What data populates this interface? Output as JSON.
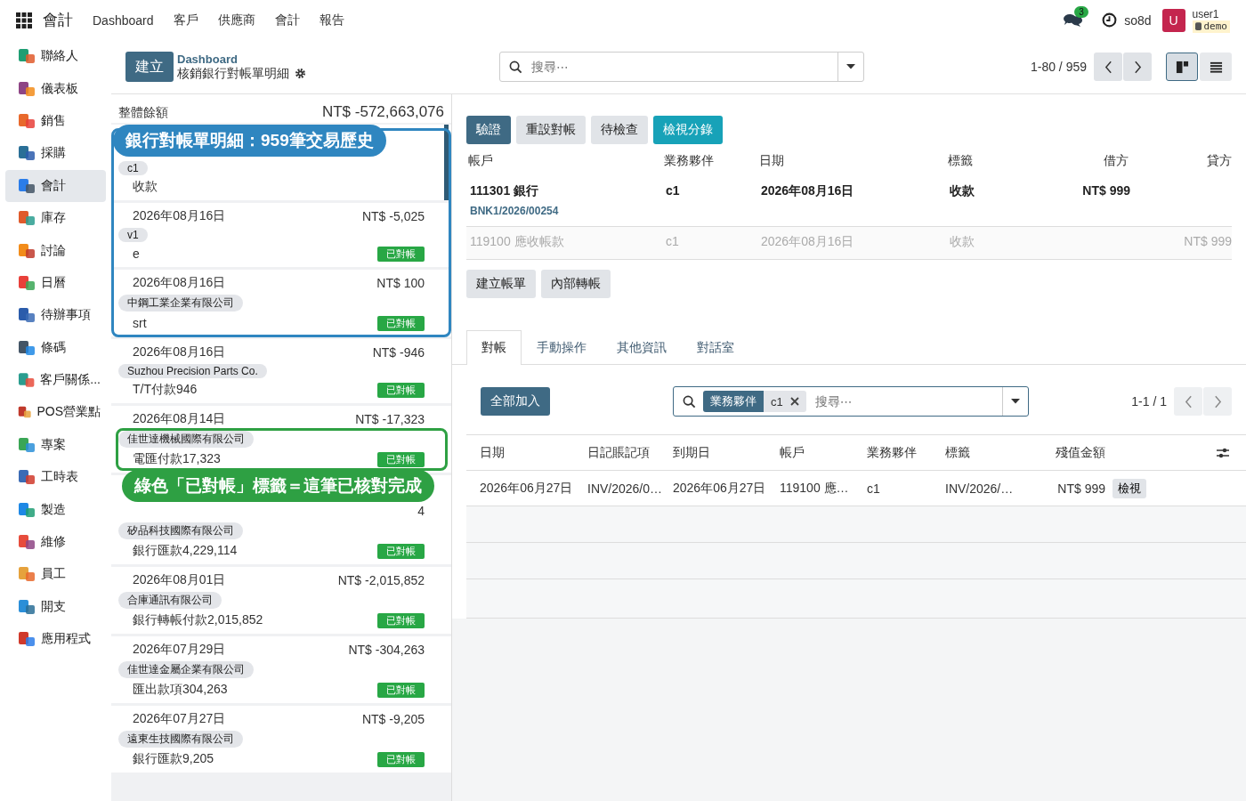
{
  "navbar": {
    "app": "會計",
    "menus": [
      "Dashboard",
      "客戶",
      "供應商",
      "會計",
      "報告"
    ],
    "messages_badge": "3",
    "clock_label": "so8d",
    "avatar": "U",
    "user": "user1",
    "database": "demo"
  },
  "sidebar": {
    "items": [
      {
        "label": "聯絡人",
        "selected": false
      },
      {
        "label": "儀表板",
        "selected": false
      },
      {
        "label": "銷售",
        "selected": false
      },
      {
        "label": "採購",
        "selected": false
      },
      {
        "label": "會計",
        "selected": true
      },
      {
        "label": "庫存",
        "selected": false
      },
      {
        "label": "討論",
        "selected": false
      },
      {
        "label": "日曆",
        "selected": false
      },
      {
        "label": "待辦事項",
        "selected": false
      },
      {
        "label": "條碼",
        "selected": false
      },
      {
        "label": "客戶關係...",
        "selected": false
      },
      {
        "label": "POS營業點",
        "selected": false
      },
      {
        "label": "專案",
        "selected": false
      },
      {
        "label": "工時表",
        "selected": false
      },
      {
        "label": "製造",
        "selected": false
      },
      {
        "label": "維修",
        "selected": false
      },
      {
        "label": "員工",
        "selected": false
      },
      {
        "label": "開支",
        "selected": false
      },
      {
        "label": "應用程式",
        "selected": false
      }
    ]
  },
  "control_panel": {
    "create": "建立",
    "breadcrumb": "Dashboard",
    "title": "核銷銀行對帳單明細",
    "search": {
      "placeholder": "搜尋⋯"
    },
    "pager": "1-80 / 959",
    "views": [
      {
        "kind": "kanban",
        "selected": true
      },
      {
        "kind": "list",
        "selected": false
      }
    ]
  },
  "statement": {
    "balance_label": "整體餘額",
    "balance": "NT$ -572,663,076",
    "lines": [
      {
        "partner": "c1",
        "label": "收款",
        "selected": true,
        "highlighted": false,
        "callout": {
          "kind": "framed",
          "text": "銀行對帳單明細：959筆交易歷史",
          "color": "#2f86c0"
        }
      },
      {
        "date": "2026年08月16日",
        "amount": "NT$ -5,025",
        "partner": "v1",
        "label": "e",
        "reconciled": true,
        "badge": "已對帳",
        "selected": false,
        "highlighted": false
      },
      {
        "date": "2026年08月16日",
        "amount": "NT$ 100",
        "partner": "中鋼工業企業有限公司",
        "label": "srt",
        "reconciled": true,
        "badge": "已對帳",
        "selected": false,
        "highlighted": false
      },
      {
        "date": "2026年08月16日",
        "amount": "NT$ -946",
        "partner": "Suzhou Precision Parts Co.",
        "label": "T/T付款946",
        "reconciled": true,
        "badge": "已對帳",
        "selected": false,
        "highlighted": false
      },
      {
        "date": "2026年08月14日",
        "amount": "NT$ -17,323",
        "partner": "佳世達機械國際有限公司",
        "label": "電匯付款17,323",
        "reconciled": true,
        "badge": "已對帳",
        "selected": false,
        "highlighted": true
      },
      {
        "amount": "4",
        "partner": "矽品科技國際有限公司",
        "label": "銀行匯款4,229,114",
        "reconciled": true,
        "badge": "已對帳",
        "selected": false,
        "highlighted": false,
        "callout": {
          "kind": "plain",
          "text": "綠色「已對帳」標籤＝這筆已核對完成",
          "color": "#2ea043"
        }
      },
      {
        "date": "2026年08月01日",
        "amount": "NT$ -2,015,852",
        "partner": "合庫通訊有限公司",
        "label": "銀行轉帳付款2,015,852",
        "reconciled": true,
        "badge": "已對帳",
        "selected": false,
        "highlighted": false
      },
      {
        "date": "2026年07月29日",
        "amount": "NT$ -304,263",
        "partner": "佳世達金屬企業有限公司",
        "label": "匯出款項304,263",
        "reconciled": true,
        "badge": "已對帳",
        "selected": false,
        "highlighted": false
      },
      {
        "date": "2026年07月27日",
        "amount": "NT$ -9,205",
        "partner": "遠東生技國際有限公司",
        "label": "銀行匯款9,205",
        "reconciled": true,
        "badge": "已對帳",
        "selected": false,
        "highlighted": false
      }
    ]
  },
  "detail": {
    "buttons": [
      {
        "label": "驗證",
        "kind": "primary"
      },
      {
        "label": "重設對帳",
        "kind": "secondary"
      },
      {
        "label": "待檢查",
        "kind": "secondary"
      },
      {
        "label": "檢視分錄",
        "kind": "info"
      }
    ],
    "columns": [
      "帳戶",
      "業務夥伴",
      "日期",
      "標籤",
      "借方",
      "貸方"
    ],
    "lines": [
      {
        "kind": "statement",
        "account": "111301 銀行",
        "reference": "BNK1/2026/00254",
        "partner": "c1",
        "date": "2026年08月16日",
        "label": "收款",
        "debit": "NT$ 999"
      },
      {
        "kind": "counterpart",
        "account": "119100 應收帳款",
        "partner": "c1",
        "date": "2026年08月16日",
        "label": "收款",
        "credit": "NT$ 999"
      }
    ],
    "actions": [
      "建立帳單",
      "內部轉帳"
    ],
    "tabs": [
      {
        "label": "對帳",
        "selected": true
      },
      {
        "label": "手動操作",
        "selected": false
      },
      {
        "label": "其他資訊",
        "selected": false
      },
      {
        "label": "對話室",
        "selected": false
      }
    ],
    "add_all": "全部加入",
    "facet": {
      "field": "業務夥伴",
      "value": "c1"
    },
    "search": {
      "placeholder": "搜尋⋯"
    },
    "pager": "1-1 / 1",
    "columns2": [
      "日期",
      "日記賬記項",
      "到期日",
      "帳戶",
      "業務夥伴",
      "標籤",
      "殘值金額"
    ],
    "rows": [
      {
        "date": "2026年06月27日",
        "entry": "INV/2026/0…",
        "due": "2026年06月27日",
        "account": "119100 應…",
        "partner": "c1",
        "label": "INV/2026/…",
        "residual": "NT$ 999",
        "action": "檢視"
      }
    ]
  }
}
